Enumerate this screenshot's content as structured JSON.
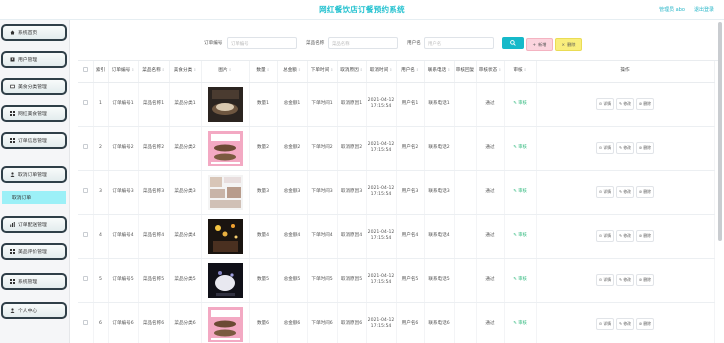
{
  "header": {
    "title": "网红餐饮店订餐预约系统",
    "user": "管理员 abo",
    "logout": "退出登录"
  },
  "sidebar": {
    "items": [
      {
        "label": "系统首页",
        "icon": "home-icon"
      },
      {
        "label": "用户管理",
        "icon": "user-icon"
      },
      {
        "label": "美食分类管理",
        "icon": "image-icon"
      },
      {
        "label": "网红美食管理",
        "icon": "grid-icon"
      },
      {
        "label": "订单信息管理",
        "icon": "grid-icon"
      },
      {
        "label": "取消订单管理",
        "icon": "person-icon"
      },
      {
        "label": "订单配送管理",
        "icon": "bar-chart-icon"
      },
      {
        "label": "美品评价管理",
        "icon": "grid-icon"
      },
      {
        "label": "系统管理",
        "icon": "grid-icon"
      },
      {
        "label": "个人中心",
        "icon": "person-icon"
      }
    ],
    "active_sub": "取消订单"
  },
  "search": {
    "order_label": "订单编号",
    "order_placeholder": "订单编号",
    "food_label": "菜品名称",
    "food_placeholder": "菜品名称",
    "user_label": "用户名",
    "user_placeholder": "用户名",
    "add_label": "新增",
    "delete_label": "删除"
  },
  "table": {
    "headers": {
      "index": "索引",
      "order_no": "订单编号",
      "food_name": "菜品名称",
      "category": "美食分类",
      "image": "图片",
      "qty": "数量",
      "total": "总金额",
      "order_time": "下单时间",
      "reason": "取消原因",
      "cancel_time": "取消时间",
      "username": "用户名",
      "phone": "联系电话",
      "reply": "审核回复",
      "status": "审核状态",
      "review": "审核",
      "ops": "操作"
    },
    "rows": [
      {
        "index": "1",
        "order_no": "订单编号1",
        "food_name": "菜品名称1",
        "category": "菜品分类1",
        "qty": "数量1",
        "total": "总金额1",
        "order_time": "下单时间1",
        "reason": "取消原因1",
        "cancel_time": "2021-04-12 17:15:54",
        "username": "用户名1",
        "phone": "联系电话1",
        "reply": "",
        "status": "通过",
        "review": "审核"
      },
      {
        "index": "2",
        "order_no": "订单编号2",
        "food_name": "菜品名称2",
        "category": "菜品分类2",
        "qty": "数量2",
        "total": "总金额2",
        "order_time": "下单时间2",
        "reason": "取消原因2",
        "cancel_time": "2021-04-12 17:15:54",
        "username": "用户名2",
        "phone": "联系电话2",
        "reply": "",
        "status": "通过",
        "review": "审核"
      },
      {
        "index": "3",
        "order_no": "订单编号3",
        "food_name": "菜品名称3",
        "category": "菜品分类3",
        "qty": "数量3",
        "total": "总金额3",
        "order_time": "下单时间3",
        "reason": "取消原因3",
        "cancel_time": "2021-04-12 17:15:54",
        "username": "用户名3",
        "phone": "联系电话3",
        "reply": "",
        "status": "通过",
        "review": "审核"
      },
      {
        "index": "4",
        "order_no": "订单编号4",
        "food_name": "菜品名称4",
        "category": "菜品分类4",
        "qty": "数量4",
        "total": "总金额4",
        "order_time": "下单时间4",
        "reason": "取消原因4",
        "cancel_time": "2021-04-12 17:15:54",
        "username": "用户名4",
        "phone": "联系电话4",
        "reply": "",
        "status": "通过",
        "review": "审核"
      },
      {
        "index": "5",
        "order_no": "订单编号5",
        "food_name": "菜品名称5",
        "category": "菜品分类5",
        "qty": "数量5",
        "total": "总金额5",
        "order_time": "下单时间5",
        "reason": "取消原因5",
        "cancel_time": "2021-04-12 17:15:54",
        "username": "用户名5",
        "phone": "联系电话5",
        "reply": "",
        "status": "通过",
        "review": "审核"
      },
      {
        "index": "6",
        "order_no": "订单编号6",
        "food_name": "菜品名称6",
        "category": "菜品分类6",
        "qty": "数量6",
        "total": "总金额6",
        "order_time": "下单时间6",
        "reason": "取消原因6",
        "cancel_time": "2021-04-12 17:15:54",
        "username": "用户名6",
        "phone": "联系电话6",
        "reply": "",
        "status": "通过",
        "review": "审核"
      }
    ],
    "row_actions": {
      "detail": "详情",
      "edit": "修改",
      "delete": "删除"
    }
  },
  "colors": {
    "accent": "#16b9c9",
    "title": "#22c1cf",
    "active_submenu": "#9cf0f7",
    "status_ok": "#2db87c"
  }
}
